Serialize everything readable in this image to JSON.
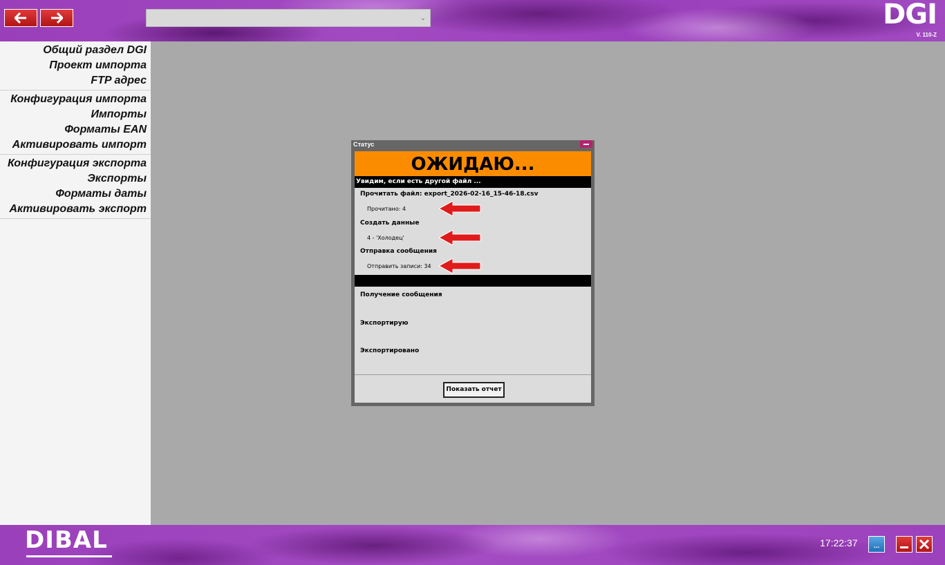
{
  "header": {
    "back_icon": "arrow-left-icon",
    "forward_icon": "arrow-right-icon",
    "combo_value": "",
    "logo_text": "DGI",
    "version": "V. 110-Z",
    "brand_color": "#9b40bc"
  },
  "sidebar": {
    "groups": [
      [
        "Общий раздел DGI",
        "Проект импорта",
        "FTP адрес"
      ],
      [
        "Конфигурация импорта",
        "Импорты",
        "Форматы EAN",
        "Активировать импорт"
      ],
      [
        "Конфигурация экспорта",
        "Экспорты",
        "Форматы даты",
        "Активировать экспорт"
      ]
    ]
  },
  "dialog": {
    "title": "Статус",
    "status": "ОЖИДАЮ...",
    "status_color": "#fb8c00",
    "info": "Увидим, если есть другой файл ...",
    "read_file": "Прочитать файл: export_2026-02-16_15-46-18.csv",
    "read_count": "Прочитано: 4",
    "create_data": "Создать данные",
    "create_value": "4 - 'Холодец'",
    "send_message": "Отправка сообщения",
    "send_value": "Отправить записи: 34",
    "receive_message": "Получение сообщения",
    "exporting": "Экспортирую",
    "exported": "Экспортировано",
    "report_button": "Показать отчет"
  },
  "footer": {
    "logo_text": "DIBAL",
    "clock": "17:22:37",
    "blue_button_label": "...",
    "minimize_icon": "minimize-icon",
    "close_icon": "close-icon"
  }
}
